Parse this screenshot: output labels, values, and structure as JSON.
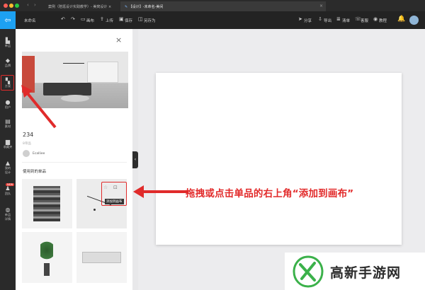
{
  "browser": {
    "tabs": [
      {
        "label": "案例（陪逛设计实践教学）- 美窝设计 ×"
      },
      {
        "label": "【设计】-未命名-美间"
      }
    ]
  },
  "toolbar": {
    "doc_title": "未命名",
    "undo_icon": "undo-icon",
    "redo_icon": "redo-icon",
    "canvas_label": "画布",
    "upload_label": "上传",
    "save_label": "保存",
    "save_as_label": "另存为",
    "share_label": "分享",
    "export_label": "导出",
    "list_label": "清单",
    "service_label": "客服",
    "tutorial_label": "教程"
  },
  "rail": {
    "items": [
      {
        "label": "单品",
        "icon": "sofa-icon"
      },
      {
        "label": "品牌",
        "icon": "tag-icon"
      },
      {
        "label": "方案",
        "icon": "layout-icon"
      },
      {
        "label": "用户",
        "icon": "user-icon"
      },
      {
        "label": "素材",
        "icon": "gift-icon"
      },
      {
        "label": "收藏夹",
        "icon": "folder-icon"
      },
      {
        "label": "我的设计",
        "icon": "bell-icon"
      },
      {
        "label": "团队",
        "icon": "team-icon"
      },
      {
        "label": "单品详情",
        "icon": "info-icon"
      }
    ],
    "new_badge": "NEW"
  },
  "panel": {
    "plan_id": "234",
    "subtitle": "8单品",
    "author": "Ecalliee",
    "section_title": "使用到的单品",
    "add_to_canvas_label": "添加到画布"
  },
  "annotation": {
    "text": "拖拽或点击单品的右上角“添加到画布”"
  },
  "watermark": {
    "text": "高新手游网"
  },
  "colors": {
    "accent": "#1da1f2",
    "highlight_red": "#e02b2b",
    "toolbar_bg": "#232323",
    "rail_bg": "#2a2a2a"
  }
}
